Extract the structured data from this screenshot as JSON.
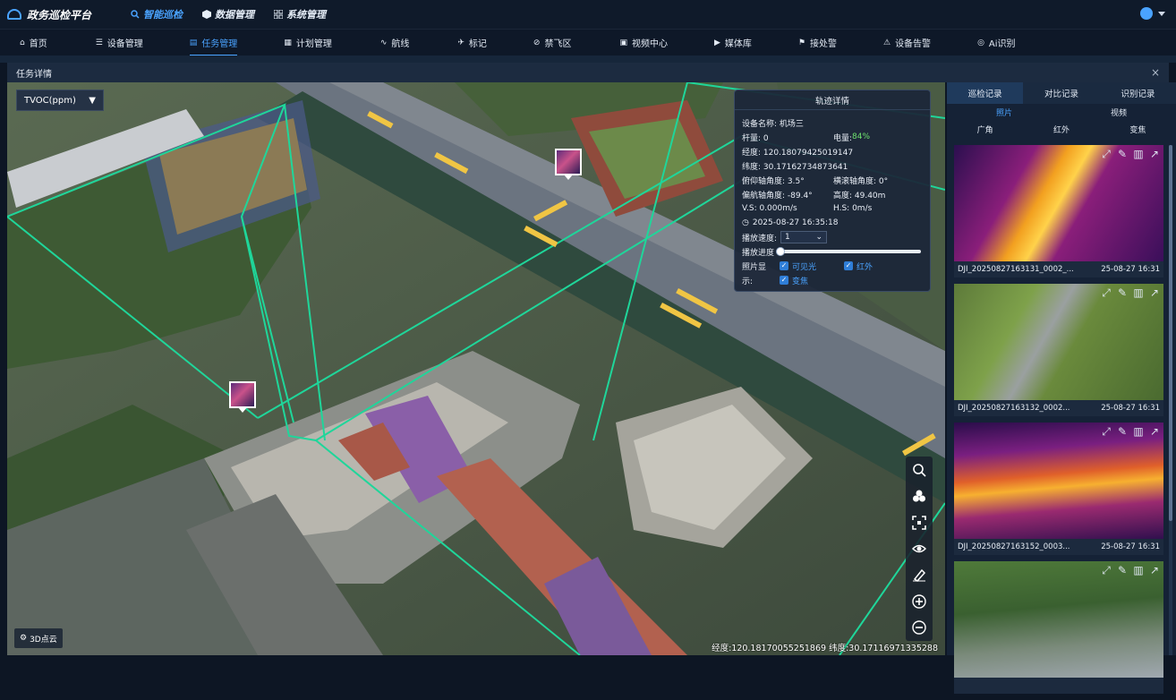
{
  "app": {
    "title": "政务巡检平台"
  },
  "topnav": [
    {
      "label": "智能巡检",
      "active": true
    },
    {
      "label": "数据管理",
      "active": false
    },
    {
      "label": "系统管理",
      "active": false
    }
  ],
  "subnav": [
    {
      "icon": "⌂",
      "label": "首页"
    },
    {
      "icon": "☰",
      "label": "设备管理"
    },
    {
      "icon": "▤",
      "label": "任务管理",
      "active": true
    },
    {
      "icon": "▦",
      "label": "计划管理"
    },
    {
      "icon": "∿",
      "label": "航线"
    },
    {
      "icon": "✈",
      "label": "标记"
    },
    {
      "icon": "⊘",
      "label": "禁飞区"
    },
    {
      "icon": "▣",
      "label": "视频中心"
    },
    {
      "icon": "▶",
      "label": "媒体库"
    },
    {
      "icon": "⚑",
      "label": "接处警"
    },
    {
      "icon": "⚠",
      "label": "设备告警"
    },
    {
      "icon": "◎",
      "label": "Ai识别"
    }
  ],
  "panel": {
    "title": "任务详情",
    "close": "×"
  },
  "map": {
    "layer_select": "TVOC(ppm)",
    "btn_3d": "3D点云",
    "coords": "经度:120.18170055251869  纬度:30.17116971335288"
  },
  "track": {
    "title": "轨迹详情",
    "device_label": "设备名称: 机场三",
    "rod_label": "杆量: 0",
    "battery_label": "电量:",
    "battery_value": "84%",
    "lng": "经度: 120.18079425019147",
    "lat": "纬度: 30.17162734873641",
    "pitch": "俯仰轴角度: 3.5°",
    "roll": "横滚轴角度: 0°",
    "yaw": "偏航轴角度: -89.4°",
    "height": "高度: 49.40m",
    "vs": "V.S: 0.000m/s",
    "hs": "H.S: 0m/s",
    "time": "2025-08-27 16:35:18",
    "speed_label": "播放速度:",
    "speed_value": "1",
    "progress_label": "播放进度",
    "progress": 0,
    "photo_label_1": "照片显",
    "photo_label_2": "示:",
    "opt_visible": "可见光",
    "opt_ir": "红外",
    "opt_zoom": "变焦"
  },
  "side": {
    "tabs": [
      {
        "label": "巡检记录",
        "active": true
      },
      {
        "label": "对比记录"
      },
      {
        "label": "识别记录"
      }
    ],
    "media_tabs": [
      {
        "label": "照片",
        "active": true
      },
      {
        "label": "视频"
      }
    ],
    "filters": [
      {
        "label": "广角"
      },
      {
        "label": "红外"
      },
      {
        "label": "变焦"
      }
    ],
    "photos": [
      {
        "name": "DJI_20250827163131_0002_...",
        "time": "25-08-27 16:31",
        "kind": "thermal"
      },
      {
        "name": "DJI_20250827163132_0002...",
        "time": "25-08-27 16:31",
        "kind": "visible"
      },
      {
        "name": "DJI_20250827163152_0003...",
        "time": "25-08-27 16:31",
        "kind": "thermal"
      },
      {
        "name": "",
        "time": "",
        "kind": "visible"
      }
    ]
  },
  "colors": {
    "accent": "#4aa3ff",
    "route": "#1fd69a",
    "battery": "#6fe36f"
  }
}
